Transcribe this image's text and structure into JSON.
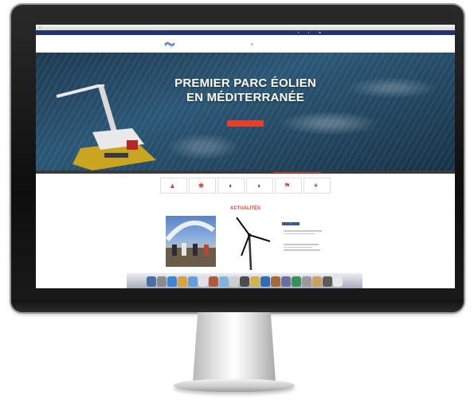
{
  "menubar": {
    "apple": "",
    "items": [],
    "status": []
  },
  "topbar": {
    "items": [],
    "social": []
  },
  "header": {
    "logo_text": "",
    "nav": []
  },
  "hero": {
    "title_line1": "PREMIER PARC ÉOLIEN",
    "title_line2": "EN MÉDITERRANÉE",
    "button_label": ""
  },
  "icons": {
    "cards": [
      {
        "icon": "thermometer-icon",
        "color": "#d84a3a"
      },
      {
        "icon": "turbine-icon",
        "color": "#c94a3a"
      },
      {
        "icon": "wave-icon",
        "color": "#2b3f8f"
      },
      {
        "icon": "wave-icon",
        "color": "#2b3f8f"
      },
      {
        "icon": "flag-icon",
        "color": "#c94a8a"
      },
      {
        "icon": "compass-icon",
        "color": "#c94a8a"
      }
    ]
  },
  "news": {
    "title": "ACTUALITÉS"
  },
  "colors": {
    "accent": "#e6402b",
    "brand": "#25336b"
  }
}
